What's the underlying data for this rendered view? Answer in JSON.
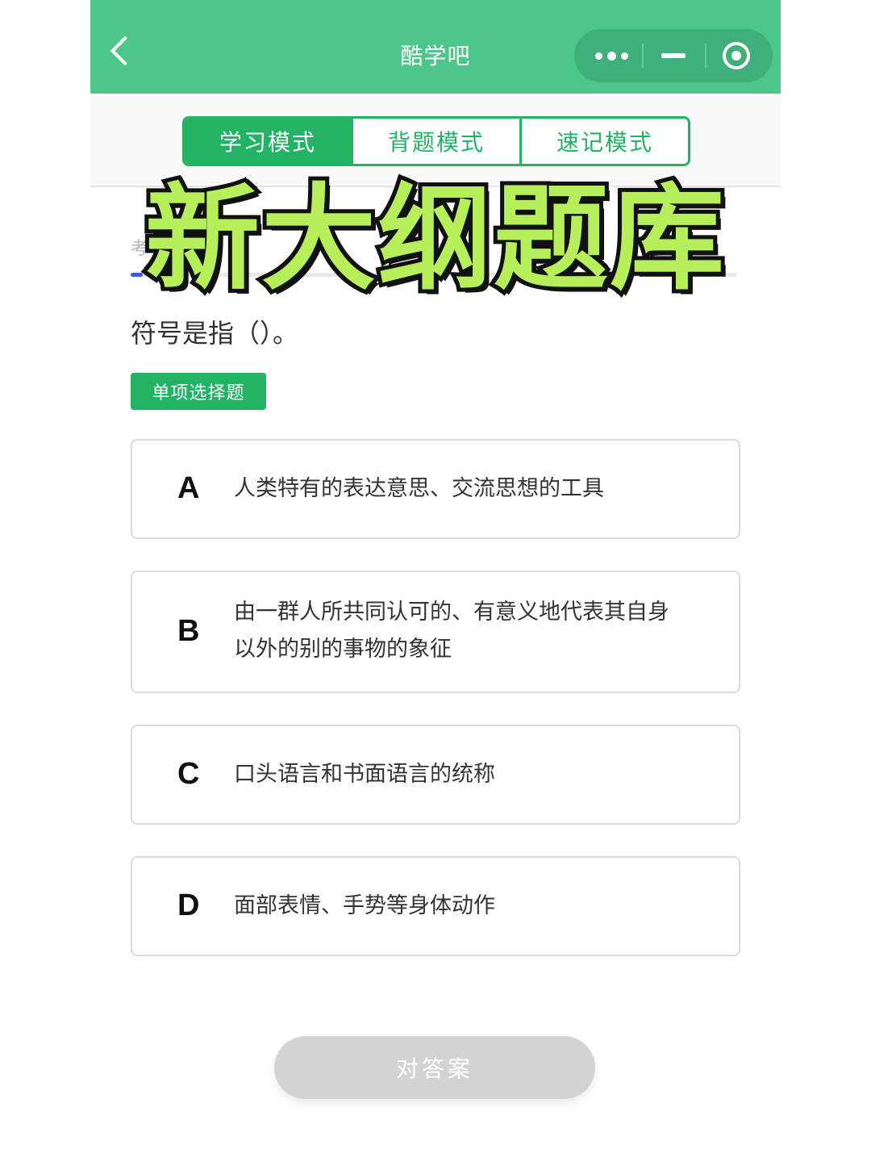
{
  "header": {
    "title": "酷学吧"
  },
  "modes": [
    {
      "label": "学习模式",
      "active": true
    },
    {
      "label": "背题模式",
      "active": false
    },
    {
      "label": "速记模式",
      "active": false
    }
  ],
  "overlay_banner": "新大纲题库",
  "partial_text": "考  诊断  的",
  "progress": {
    "fraction": 0.02
  },
  "question": {
    "text": "符号是指（）。",
    "type_label": "单项选择题"
  },
  "options": [
    {
      "letter": "A",
      "text": "人类特有的表达意思、交流思想的工具"
    },
    {
      "letter": "B",
      "text": "由一群人所共同认可的、有意义地代表其自身以外的别的事物的象征"
    },
    {
      "letter": "C",
      "text": "口头语言和书面语言的统称"
    },
    {
      "letter": "D",
      "text": "面部表情、手势等身体动作"
    }
  ],
  "submit_label": "对答案",
  "colors": {
    "topbar": "#4cc68a",
    "accent": "#22b365",
    "banner_fill": "#b6ef5a",
    "progress": "#3a5bd9",
    "submit_disabled": "#d3d3d3"
  },
  "icons": [
    "back-arrow-icon",
    "more-dots-icon",
    "minimize-icon",
    "close-target-icon"
  ]
}
